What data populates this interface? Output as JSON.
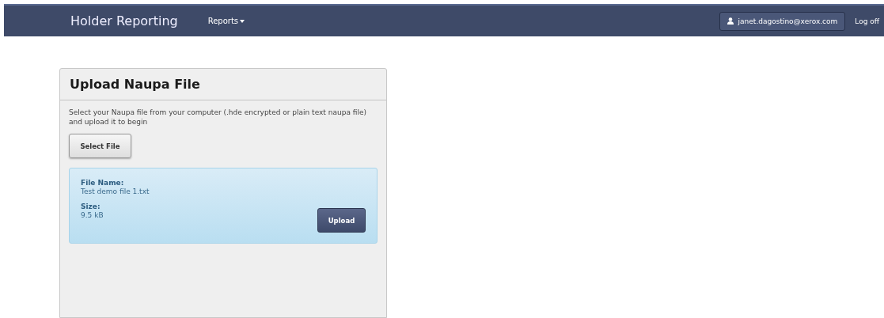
{
  "navbar": {
    "brand": "Holder Reporting",
    "menu": "Reports",
    "user": "janet.dagostino@xerox.com",
    "logoff": "Log off"
  },
  "panel": {
    "title": "Upload Naupa File",
    "description": "Select your Naupa file from your computer (.hde encrypted or plain text naupa file) and upload it to begin",
    "select_button": "Select File",
    "file": {
      "name_label": "File Name:",
      "name": "Test demo file 1.txt",
      "size_label": "Size:",
      "size": "9.5 kB",
      "upload_button": "Upload"
    }
  }
}
